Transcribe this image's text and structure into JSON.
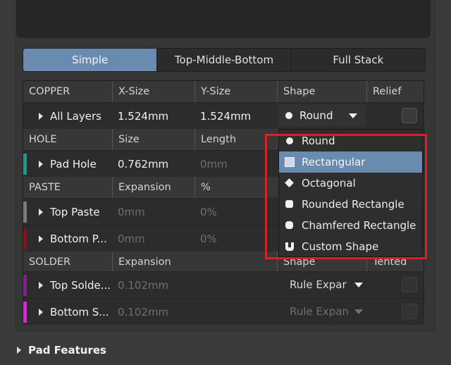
{
  "tabs": [
    "Simple",
    "Top-Middle-Bottom",
    "Full Stack"
  ],
  "copper": {
    "headers": [
      "COPPER",
      "X-Size",
      "Y-Size",
      "Shape",
      "Relief"
    ],
    "row": {
      "label": "All Layers",
      "x": "1.524mm",
      "y": "1.524mm",
      "shape": "Round"
    }
  },
  "hole": {
    "headers": [
      "HOLE",
      "Size",
      "Length"
    ],
    "row": {
      "label": "Pad Hole",
      "size": "0.762mm",
      "length": "0mm",
      "color": "#1a9a8e"
    }
  },
  "paste": {
    "headers": [
      "PASTE",
      "Expansion",
      "%"
    ],
    "rows": [
      {
        "label": "Top Paste",
        "expansion": "0mm",
        "pct": "0%",
        "color": "#7a7a7a"
      },
      {
        "label": "Bottom P...",
        "expansion": "0mm",
        "pct": "0%",
        "color": "#8a0f14"
      }
    ]
  },
  "solder": {
    "headers": [
      "SOLDER",
      "Expansion",
      "Shape",
      "Tented"
    ],
    "rows": [
      {
        "label": "Top Solde...",
        "expansion": "0.102mm",
        "shape": "Rule Expar",
        "color": "#8a1a9a"
      },
      {
        "label": "Bottom S...",
        "expansion": "0.102mm",
        "shape": "Rule Expan",
        "color": "#e81ee8"
      }
    ]
  },
  "dropdown": {
    "items": [
      {
        "label": "Round",
        "icon": "round-icon"
      },
      {
        "label": "Rectangular",
        "icon": "rectangle-icon",
        "selected": true
      },
      {
        "label": "Octagonal",
        "icon": "octagon-icon"
      },
      {
        "label": "Rounded Rectangle",
        "icon": "rounded-rectangle-icon"
      },
      {
        "label": "Chamfered Rectangle",
        "icon": "chamfered-rectangle-icon"
      },
      {
        "label": "Custom Shape",
        "icon": "custom-shape-icon"
      }
    ]
  },
  "pad_features": "Pad Features",
  "colors": {
    "accent": "#6a8bb0",
    "highlight_border": "#d8202a"
  }
}
